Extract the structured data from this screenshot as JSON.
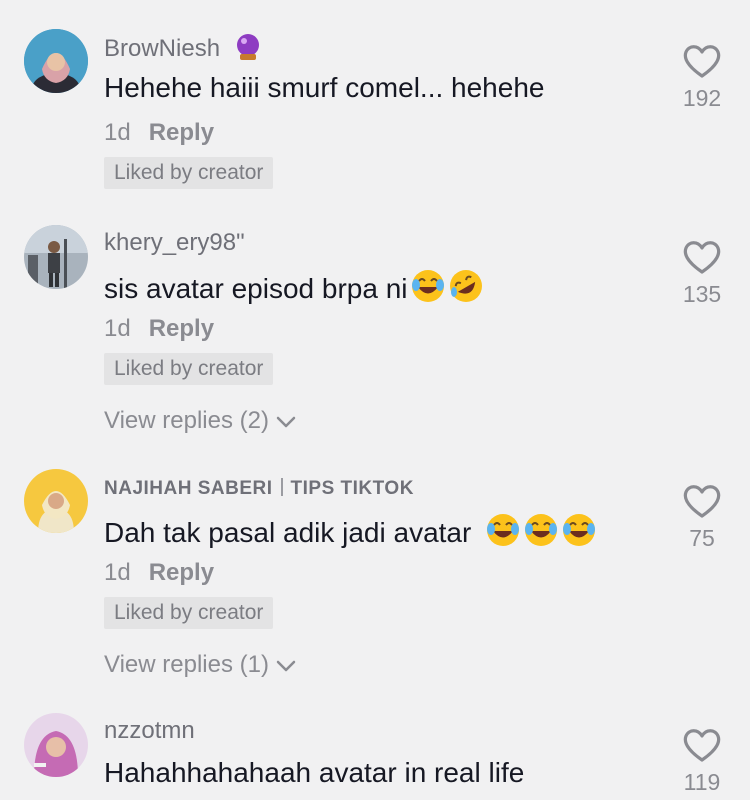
{
  "comments": [
    {
      "username": "BrowNiesh",
      "badge_icon": "crystal-ball-icon",
      "text": "Hehehe haiii smurf comel... hehehe",
      "time": "1d",
      "reply_label": "Reply",
      "liked_label": "Liked by creator",
      "likes": "192"
    },
    {
      "username": "khery_ery98\"",
      "text": "sis avatar episod brpa ni",
      "emojis": [
        "face-with-tears-of-joy-icon",
        "rolling-on-floor-laughing-icon"
      ],
      "time": "1d",
      "reply_label": "Reply",
      "liked_label": "Liked by creator",
      "view_replies": "View replies (2)",
      "likes": "135"
    },
    {
      "username_part1": "NAJIHAH SABERI",
      "username_part2": "TIPS TIKTOK",
      "text": "Dah tak pasal adik jadi avatar",
      "emojis": [
        "face-with-tears-of-joy-icon",
        "face-with-tears-of-joy-icon",
        "face-with-tears-of-joy-icon"
      ],
      "time": "1d",
      "reply_label": "Reply",
      "liked_label": "Liked by creator",
      "view_replies": "View replies (1)",
      "likes": "75"
    },
    {
      "username": "nzzotmn",
      "text": "Hahahhahahaah avatar in real life",
      "likes": "119"
    }
  ],
  "colors": {
    "background": "#f1f1f2",
    "text_primary": "#161823",
    "text_secondary": "#8a8b91",
    "liked_badge_bg": "#e3e3e4"
  }
}
